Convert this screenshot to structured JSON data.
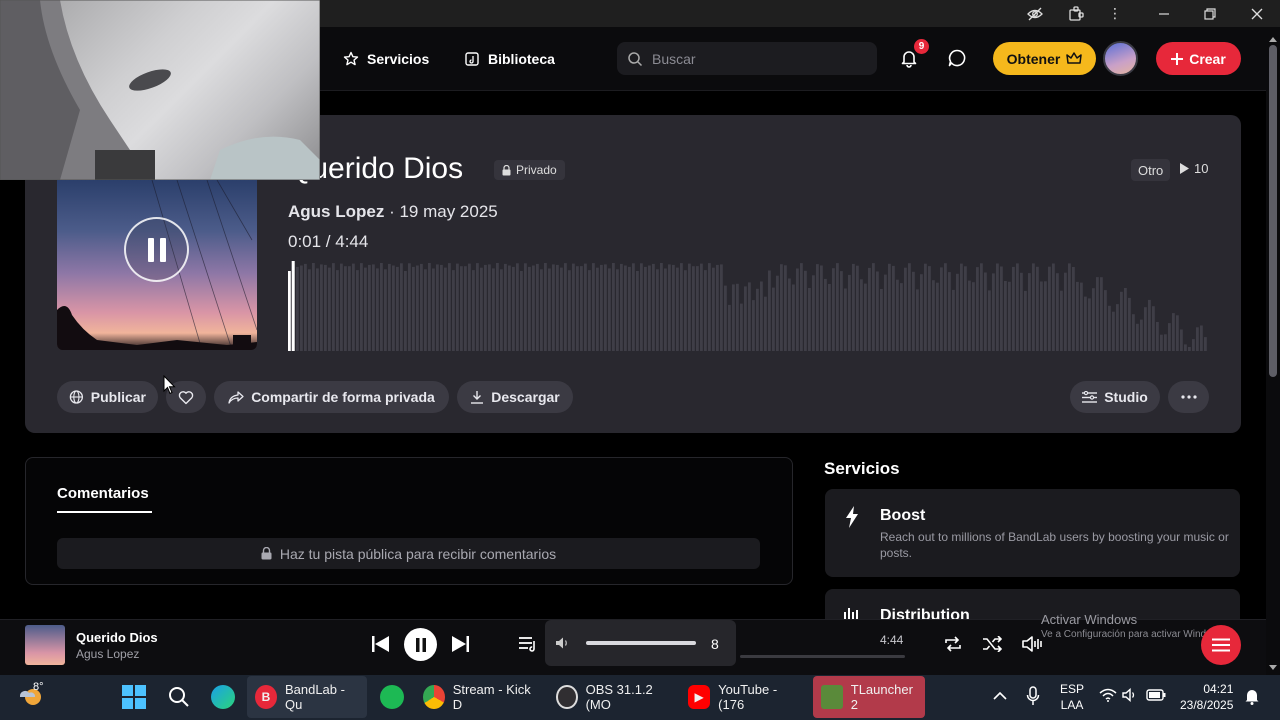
{
  "header": {
    "nav_services": "Servicios",
    "nav_library": "Biblioteca",
    "search_placeholder": "Buscar",
    "notification_count": "9",
    "get_label": "Obtener",
    "create_label": "Crear"
  },
  "track": {
    "title": "Querido Dios",
    "privacy": "Privado",
    "artist": "Agus Lopez",
    "date": "· 19 may 2025",
    "time": "0:01 /  4:44",
    "genre": "Otro",
    "plays": "10",
    "progress_fraction": 0.004
  },
  "actions": {
    "publish": "Publicar",
    "share_private": "Compartir de forma privada",
    "download": "Descargar",
    "studio": "Studio"
  },
  "comments": {
    "tab": "Comentarios",
    "locked_message": "Haz tu pista pública para recibir comentarios"
  },
  "services": {
    "title": "Servicios",
    "boost_title": "Boost",
    "boost_desc": "Reach out to millions of BandLab users by boosting your music or posts.",
    "distribution_title": "Distribution"
  },
  "player": {
    "title": "Querido Dios",
    "artist": "Agus Lopez",
    "volume": "8",
    "duration": "4:44"
  },
  "watermark": {
    "line1": "Activar Windows",
    "line2": "Ve a Configuración para activar Windows."
  },
  "taskbar": {
    "weather_temp": "8°",
    "apps": [
      {
        "label": "BandLab - Qu"
      },
      {
        "label": "Stream - Kick D"
      },
      {
        "label": "OBS 31.1.2 (MO"
      },
      {
        "label": "YouTube - (176"
      },
      {
        "label": "TLauncher 2"
      }
    ],
    "lang_line1": "ESP",
    "lang_line2": "LAA",
    "time": "04:21",
    "date": "23/8/2025"
  },
  "colors": {
    "accent_red": "#e7283a",
    "accent_gold": "#f5b81c",
    "card_bg": "#29282f"
  }
}
